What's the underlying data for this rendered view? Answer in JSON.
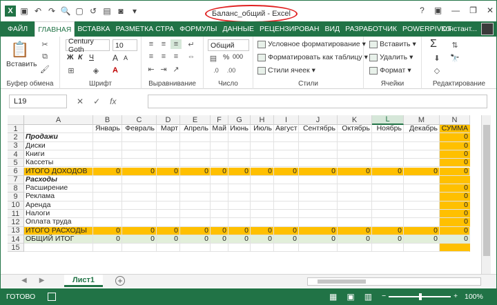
{
  "window": {
    "title": "Баланс_общий - Excel",
    "help": "?",
    "minimize": "—",
    "restore": "❐",
    "close": "✕"
  },
  "tabs": [
    "ФАЙЛ",
    "ГЛАВНАЯ",
    "ВСТАВКА",
    "РАЗМЕТКА СТРА",
    "ФОРМУЛЫ",
    "ДАННЫЕ",
    "РЕЦЕНЗИРОВАН",
    "ВИД",
    "РАЗРАБОТЧИК",
    "POWERPIVOT"
  ],
  "active_tab": "ГЛАВНАЯ",
  "account": "Констант...",
  "ribbon": {
    "clipboard": {
      "label": "Буфер обмена",
      "paste": "Вставить"
    },
    "font": {
      "label": "Шрифт",
      "name": "Century Goth",
      "size": "10",
      "bold": "Ж",
      "italic": "К",
      "underline": "Ч",
      "grow": "A",
      "shrink": "A"
    },
    "alignment": {
      "label": "Выравнивание"
    },
    "number": {
      "label": "Число",
      "format": "Общий",
      "percent": "%",
      "thousands": "000"
    },
    "styles": {
      "label": "Стили",
      "conditional": "Условное форматирование",
      "table": "Форматировать как таблицу",
      "cell_styles": "Стили ячеек"
    },
    "cells": {
      "label": "Ячейки",
      "insert": "Вставить",
      "delete": "Удалить",
      "format": "Формат"
    },
    "editing": {
      "label": "Редактирование",
      "sum": "Σ"
    }
  },
  "formula_bar": {
    "name_box": "L19",
    "cancel": "✕",
    "enter": "✓",
    "fx": "fx",
    "value": ""
  },
  "columns": [
    "A",
    "B",
    "C",
    "D",
    "E",
    "F",
    "G",
    "H",
    "I",
    "J",
    "K",
    "L",
    "M",
    "N"
  ],
  "selected_column": "L",
  "rows": [
    {
      "n": "1",
      "a": "",
      "vals": [
        "Январь",
        "Февраль",
        "Март",
        "Апрель",
        "Май",
        "Июнь",
        "Июль",
        "Август",
        "Сентябрь",
        "Октябрь",
        "Ноябрь",
        "Декабрь",
        "СУММА"
      ],
      "type": "header"
    },
    {
      "n": "2",
      "a": "Продажи",
      "vals": [
        "",
        "",
        "",
        "",
        "",
        "",
        "",
        "",
        "",
        "",
        "",
        "",
        "0"
      ],
      "type": "section"
    },
    {
      "n": "3",
      "a": "Диски",
      "vals": [
        "",
        "",
        "",
        "",
        "",
        "",
        "",
        "",
        "",
        "",
        "",
        "",
        "0"
      ],
      "type": "item"
    },
    {
      "n": "4",
      "a": "Книги",
      "vals": [
        "",
        "",
        "",
        "",
        "",
        "",
        "",
        "",
        "",
        "",
        "",
        "",
        "0"
      ],
      "type": "item"
    },
    {
      "n": "5",
      "a": "Кассеты",
      "vals": [
        "",
        "",
        "",
        "",
        "",
        "",
        "",
        "",
        "",
        "",
        "",
        "",
        "0"
      ],
      "type": "item"
    },
    {
      "n": "6",
      "a": "ИТОГО ДОХОДОВ",
      "vals": [
        "0",
        "0",
        "0",
        "0",
        "0",
        "0",
        "0",
        "0",
        "0",
        "0",
        "0",
        "0",
        "0"
      ],
      "type": "total"
    },
    {
      "n": "7",
      "a": "Расходы",
      "vals": [
        "",
        "",
        "",
        "",
        "",
        "",
        "",
        "",
        "",
        "",
        "",
        "",
        ""
      ],
      "type": "section"
    },
    {
      "n": "8",
      "a": "Расширение",
      "vals": [
        "",
        "",
        "",
        "",
        "",
        "",
        "",
        "",
        "",
        "",
        "",
        "",
        "0"
      ],
      "type": "item"
    },
    {
      "n": "9",
      "a": "Реклама",
      "vals": [
        "",
        "",
        "",
        "",
        "",
        "",
        "",
        "",
        "",
        "",
        "",
        "",
        "0"
      ],
      "type": "item"
    },
    {
      "n": "10",
      "a": "Аренда",
      "vals": [
        "",
        "",
        "",
        "",
        "",
        "",
        "",
        "",
        "",
        "",
        "",
        "",
        "0"
      ],
      "type": "item"
    },
    {
      "n": "11",
      "a": "Налоги",
      "vals": [
        "",
        "",
        "",
        "",
        "",
        "",
        "",
        "",
        "",
        "",
        "",
        "",
        "0"
      ],
      "type": "item"
    },
    {
      "n": "12",
      "a": "Оплата труда",
      "vals": [
        "",
        "",
        "",
        "",
        "",
        "",
        "",
        "",
        "",
        "",
        "",
        "",
        "0"
      ],
      "type": "item"
    },
    {
      "n": "13",
      "a": "ИТОГО РАСХОДЫ",
      "vals": [
        "0",
        "0",
        "0",
        "0",
        "0",
        "0",
        "0",
        "0",
        "0",
        "0",
        "0",
        "0",
        "0"
      ],
      "type": "total"
    },
    {
      "n": "14",
      "a": "ОБЩИЙ ИТОГ",
      "vals": [
        "0",
        "0",
        "0",
        "0",
        "0",
        "0",
        "0",
        "0",
        "0",
        "0",
        "0",
        "0",
        "0"
      ],
      "type": "grand"
    },
    {
      "n": "15",
      "a": "",
      "vals": [
        "",
        "",
        "",
        "",
        "",
        "",
        "",
        "",
        "",
        "",
        "",
        "",
        ""
      ],
      "type": "empty"
    }
  ],
  "sheet": {
    "name": "Лист1",
    "add": "+"
  },
  "status": {
    "ready": "ГОТОВО",
    "zoom": "100%",
    "minus": "−",
    "plus": "+"
  },
  "colors": {
    "accent": "#217346",
    "highlight": "#ffc000",
    "grand_total": "#e2efda"
  }
}
